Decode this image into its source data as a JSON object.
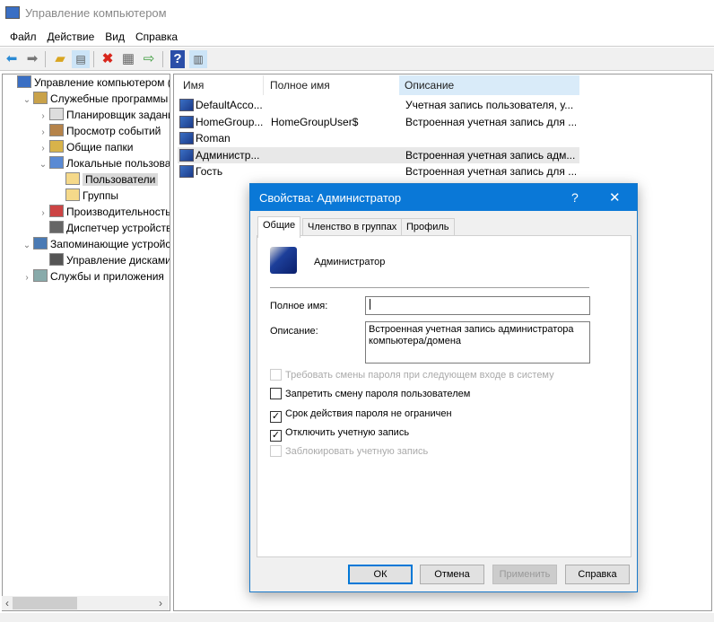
{
  "window": {
    "title": "Управление компьютером"
  },
  "menu": [
    "Файл",
    "Действие",
    "Вид",
    "Справка"
  ],
  "tree": [
    {
      "label": "Управление компьютером (л",
      "level": 0,
      "chev": ""
    },
    {
      "label": "Служебные программы",
      "level": 1,
      "chev": "⌄"
    },
    {
      "label": "Планировщик заданий",
      "level": 2,
      "chev": "›"
    },
    {
      "label": "Просмотр событий",
      "level": 2,
      "chev": "›"
    },
    {
      "label": "Общие папки",
      "level": 2,
      "chev": "›"
    },
    {
      "label": "Локальные пользовате",
      "level": 2,
      "chev": "⌄"
    },
    {
      "label": "Пользователи",
      "level": 3,
      "chev": ""
    },
    {
      "label": "Группы",
      "level": 3,
      "chev": ""
    },
    {
      "label": "Производительность",
      "level": 2,
      "chev": "›"
    },
    {
      "label": "Диспетчер устройств",
      "level": 2,
      "chev": ""
    },
    {
      "label": "Запоминающие устройст",
      "level": 1,
      "chev": "⌄"
    },
    {
      "label": "Управление дисками",
      "level": 2,
      "chev": ""
    },
    {
      "label": "Службы и приложения",
      "level": 1,
      "chev": "›"
    }
  ],
  "list": {
    "headers": [
      "Имя",
      "Полное имя",
      "Описание"
    ],
    "rows": [
      {
        "name": "DefaultAcco...",
        "full": "",
        "desc": "Учетная запись пользователя, у..."
      },
      {
        "name": "HomeGroup...",
        "full": "HomeGroupUser$",
        "desc": "Встроенная учетная запись для ..."
      },
      {
        "name": "Roman",
        "full": "",
        "desc": ""
      },
      {
        "name": "Администр...",
        "full": "",
        "desc": "Встроенная учетная запись адм..."
      },
      {
        "name": "Гость",
        "full": "",
        "desc": "Встроенная учетная запись для ..."
      }
    ]
  },
  "dialog": {
    "title": "Свойства: Администратор",
    "help": "?",
    "close": "✕",
    "tabs": [
      "Общие",
      "Членство в группах",
      "Профиль"
    ],
    "username": "Администратор",
    "fullname_label": "Полное имя:",
    "fullname_value": "",
    "desc_label": "Описание:",
    "desc_value": "Встроенная учетная запись администратора компьютера/домена",
    "checkboxes": [
      {
        "label": "Требовать смены пароля при следующем входе в систему",
        "checked": false,
        "disabled": true
      },
      {
        "label": "Запретить смену пароля пользователем",
        "checked": false,
        "disabled": false
      },
      {
        "label": "Срок действия пароля не ограничен",
        "checked": true,
        "disabled": false
      },
      {
        "label": "Отключить учетную запись",
        "checked": true,
        "disabled": false
      },
      {
        "label": "Заблокировать учетную запись",
        "checked": false,
        "disabled": true
      }
    ],
    "buttons": {
      "ok": "ОК",
      "cancel": "Отмена",
      "apply": "Применить",
      "help": "Справка"
    }
  }
}
